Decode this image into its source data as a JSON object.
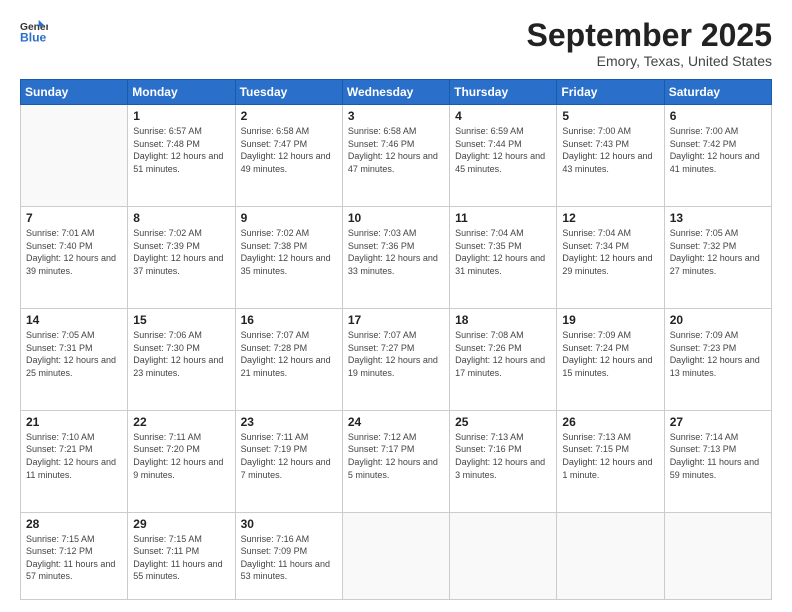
{
  "header": {
    "logo_line1": "General",
    "logo_line2": "Blue",
    "month": "September 2025",
    "location": "Emory, Texas, United States"
  },
  "weekdays": [
    "Sunday",
    "Monday",
    "Tuesday",
    "Wednesday",
    "Thursday",
    "Friday",
    "Saturday"
  ],
  "weeks": [
    [
      {
        "day": "",
        "sunrise": "",
        "sunset": "",
        "daylight": ""
      },
      {
        "day": "1",
        "sunrise": "Sunrise: 6:57 AM",
        "sunset": "Sunset: 7:48 PM",
        "daylight": "Daylight: 12 hours and 51 minutes."
      },
      {
        "day": "2",
        "sunrise": "Sunrise: 6:58 AM",
        "sunset": "Sunset: 7:47 PM",
        "daylight": "Daylight: 12 hours and 49 minutes."
      },
      {
        "day": "3",
        "sunrise": "Sunrise: 6:58 AM",
        "sunset": "Sunset: 7:46 PM",
        "daylight": "Daylight: 12 hours and 47 minutes."
      },
      {
        "day": "4",
        "sunrise": "Sunrise: 6:59 AM",
        "sunset": "Sunset: 7:44 PM",
        "daylight": "Daylight: 12 hours and 45 minutes."
      },
      {
        "day": "5",
        "sunrise": "Sunrise: 7:00 AM",
        "sunset": "Sunset: 7:43 PM",
        "daylight": "Daylight: 12 hours and 43 minutes."
      },
      {
        "day": "6",
        "sunrise": "Sunrise: 7:00 AM",
        "sunset": "Sunset: 7:42 PM",
        "daylight": "Daylight: 12 hours and 41 minutes."
      }
    ],
    [
      {
        "day": "7",
        "sunrise": "Sunrise: 7:01 AM",
        "sunset": "Sunset: 7:40 PM",
        "daylight": "Daylight: 12 hours and 39 minutes."
      },
      {
        "day": "8",
        "sunrise": "Sunrise: 7:02 AM",
        "sunset": "Sunset: 7:39 PM",
        "daylight": "Daylight: 12 hours and 37 minutes."
      },
      {
        "day": "9",
        "sunrise": "Sunrise: 7:02 AM",
        "sunset": "Sunset: 7:38 PM",
        "daylight": "Daylight: 12 hours and 35 minutes."
      },
      {
        "day": "10",
        "sunrise": "Sunrise: 7:03 AM",
        "sunset": "Sunset: 7:36 PM",
        "daylight": "Daylight: 12 hours and 33 minutes."
      },
      {
        "day": "11",
        "sunrise": "Sunrise: 7:04 AM",
        "sunset": "Sunset: 7:35 PM",
        "daylight": "Daylight: 12 hours and 31 minutes."
      },
      {
        "day": "12",
        "sunrise": "Sunrise: 7:04 AM",
        "sunset": "Sunset: 7:34 PM",
        "daylight": "Daylight: 12 hours and 29 minutes."
      },
      {
        "day": "13",
        "sunrise": "Sunrise: 7:05 AM",
        "sunset": "Sunset: 7:32 PM",
        "daylight": "Daylight: 12 hours and 27 minutes."
      }
    ],
    [
      {
        "day": "14",
        "sunrise": "Sunrise: 7:05 AM",
        "sunset": "Sunset: 7:31 PM",
        "daylight": "Daylight: 12 hours and 25 minutes."
      },
      {
        "day": "15",
        "sunrise": "Sunrise: 7:06 AM",
        "sunset": "Sunset: 7:30 PM",
        "daylight": "Daylight: 12 hours and 23 minutes."
      },
      {
        "day": "16",
        "sunrise": "Sunrise: 7:07 AM",
        "sunset": "Sunset: 7:28 PM",
        "daylight": "Daylight: 12 hours and 21 minutes."
      },
      {
        "day": "17",
        "sunrise": "Sunrise: 7:07 AM",
        "sunset": "Sunset: 7:27 PM",
        "daylight": "Daylight: 12 hours and 19 minutes."
      },
      {
        "day": "18",
        "sunrise": "Sunrise: 7:08 AM",
        "sunset": "Sunset: 7:26 PM",
        "daylight": "Daylight: 12 hours and 17 minutes."
      },
      {
        "day": "19",
        "sunrise": "Sunrise: 7:09 AM",
        "sunset": "Sunset: 7:24 PM",
        "daylight": "Daylight: 12 hours and 15 minutes."
      },
      {
        "day": "20",
        "sunrise": "Sunrise: 7:09 AM",
        "sunset": "Sunset: 7:23 PM",
        "daylight": "Daylight: 12 hours and 13 minutes."
      }
    ],
    [
      {
        "day": "21",
        "sunrise": "Sunrise: 7:10 AM",
        "sunset": "Sunset: 7:21 PM",
        "daylight": "Daylight: 12 hours and 11 minutes."
      },
      {
        "day": "22",
        "sunrise": "Sunrise: 7:11 AM",
        "sunset": "Sunset: 7:20 PM",
        "daylight": "Daylight: 12 hours and 9 minutes."
      },
      {
        "day": "23",
        "sunrise": "Sunrise: 7:11 AM",
        "sunset": "Sunset: 7:19 PM",
        "daylight": "Daylight: 12 hours and 7 minutes."
      },
      {
        "day": "24",
        "sunrise": "Sunrise: 7:12 AM",
        "sunset": "Sunset: 7:17 PM",
        "daylight": "Daylight: 12 hours and 5 minutes."
      },
      {
        "day": "25",
        "sunrise": "Sunrise: 7:13 AM",
        "sunset": "Sunset: 7:16 PM",
        "daylight": "Daylight: 12 hours and 3 minutes."
      },
      {
        "day": "26",
        "sunrise": "Sunrise: 7:13 AM",
        "sunset": "Sunset: 7:15 PM",
        "daylight": "Daylight: 12 hours and 1 minute."
      },
      {
        "day": "27",
        "sunrise": "Sunrise: 7:14 AM",
        "sunset": "Sunset: 7:13 PM",
        "daylight": "Daylight: 11 hours and 59 minutes."
      }
    ],
    [
      {
        "day": "28",
        "sunrise": "Sunrise: 7:15 AM",
        "sunset": "Sunset: 7:12 PM",
        "daylight": "Daylight: 11 hours and 57 minutes."
      },
      {
        "day": "29",
        "sunrise": "Sunrise: 7:15 AM",
        "sunset": "Sunset: 7:11 PM",
        "daylight": "Daylight: 11 hours and 55 minutes."
      },
      {
        "day": "30",
        "sunrise": "Sunrise: 7:16 AM",
        "sunset": "Sunset: 7:09 PM",
        "daylight": "Daylight: 11 hours and 53 minutes."
      },
      {
        "day": "",
        "sunrise": "",
        "sunset": "",
        "daylight": ""
      },
      {
        "day": "",
        "sunrise": "",
        "sunset": "",
        "daylight": ""
      },
      {
        "day": "",
        "sunrise": "",
        "sunset": "",
        "daylight": ""
      },
      {
        "day": "",
        "sunrise": "",
        "sunset": "",
        "daylight": ""
      }
    ]
  ]
}
